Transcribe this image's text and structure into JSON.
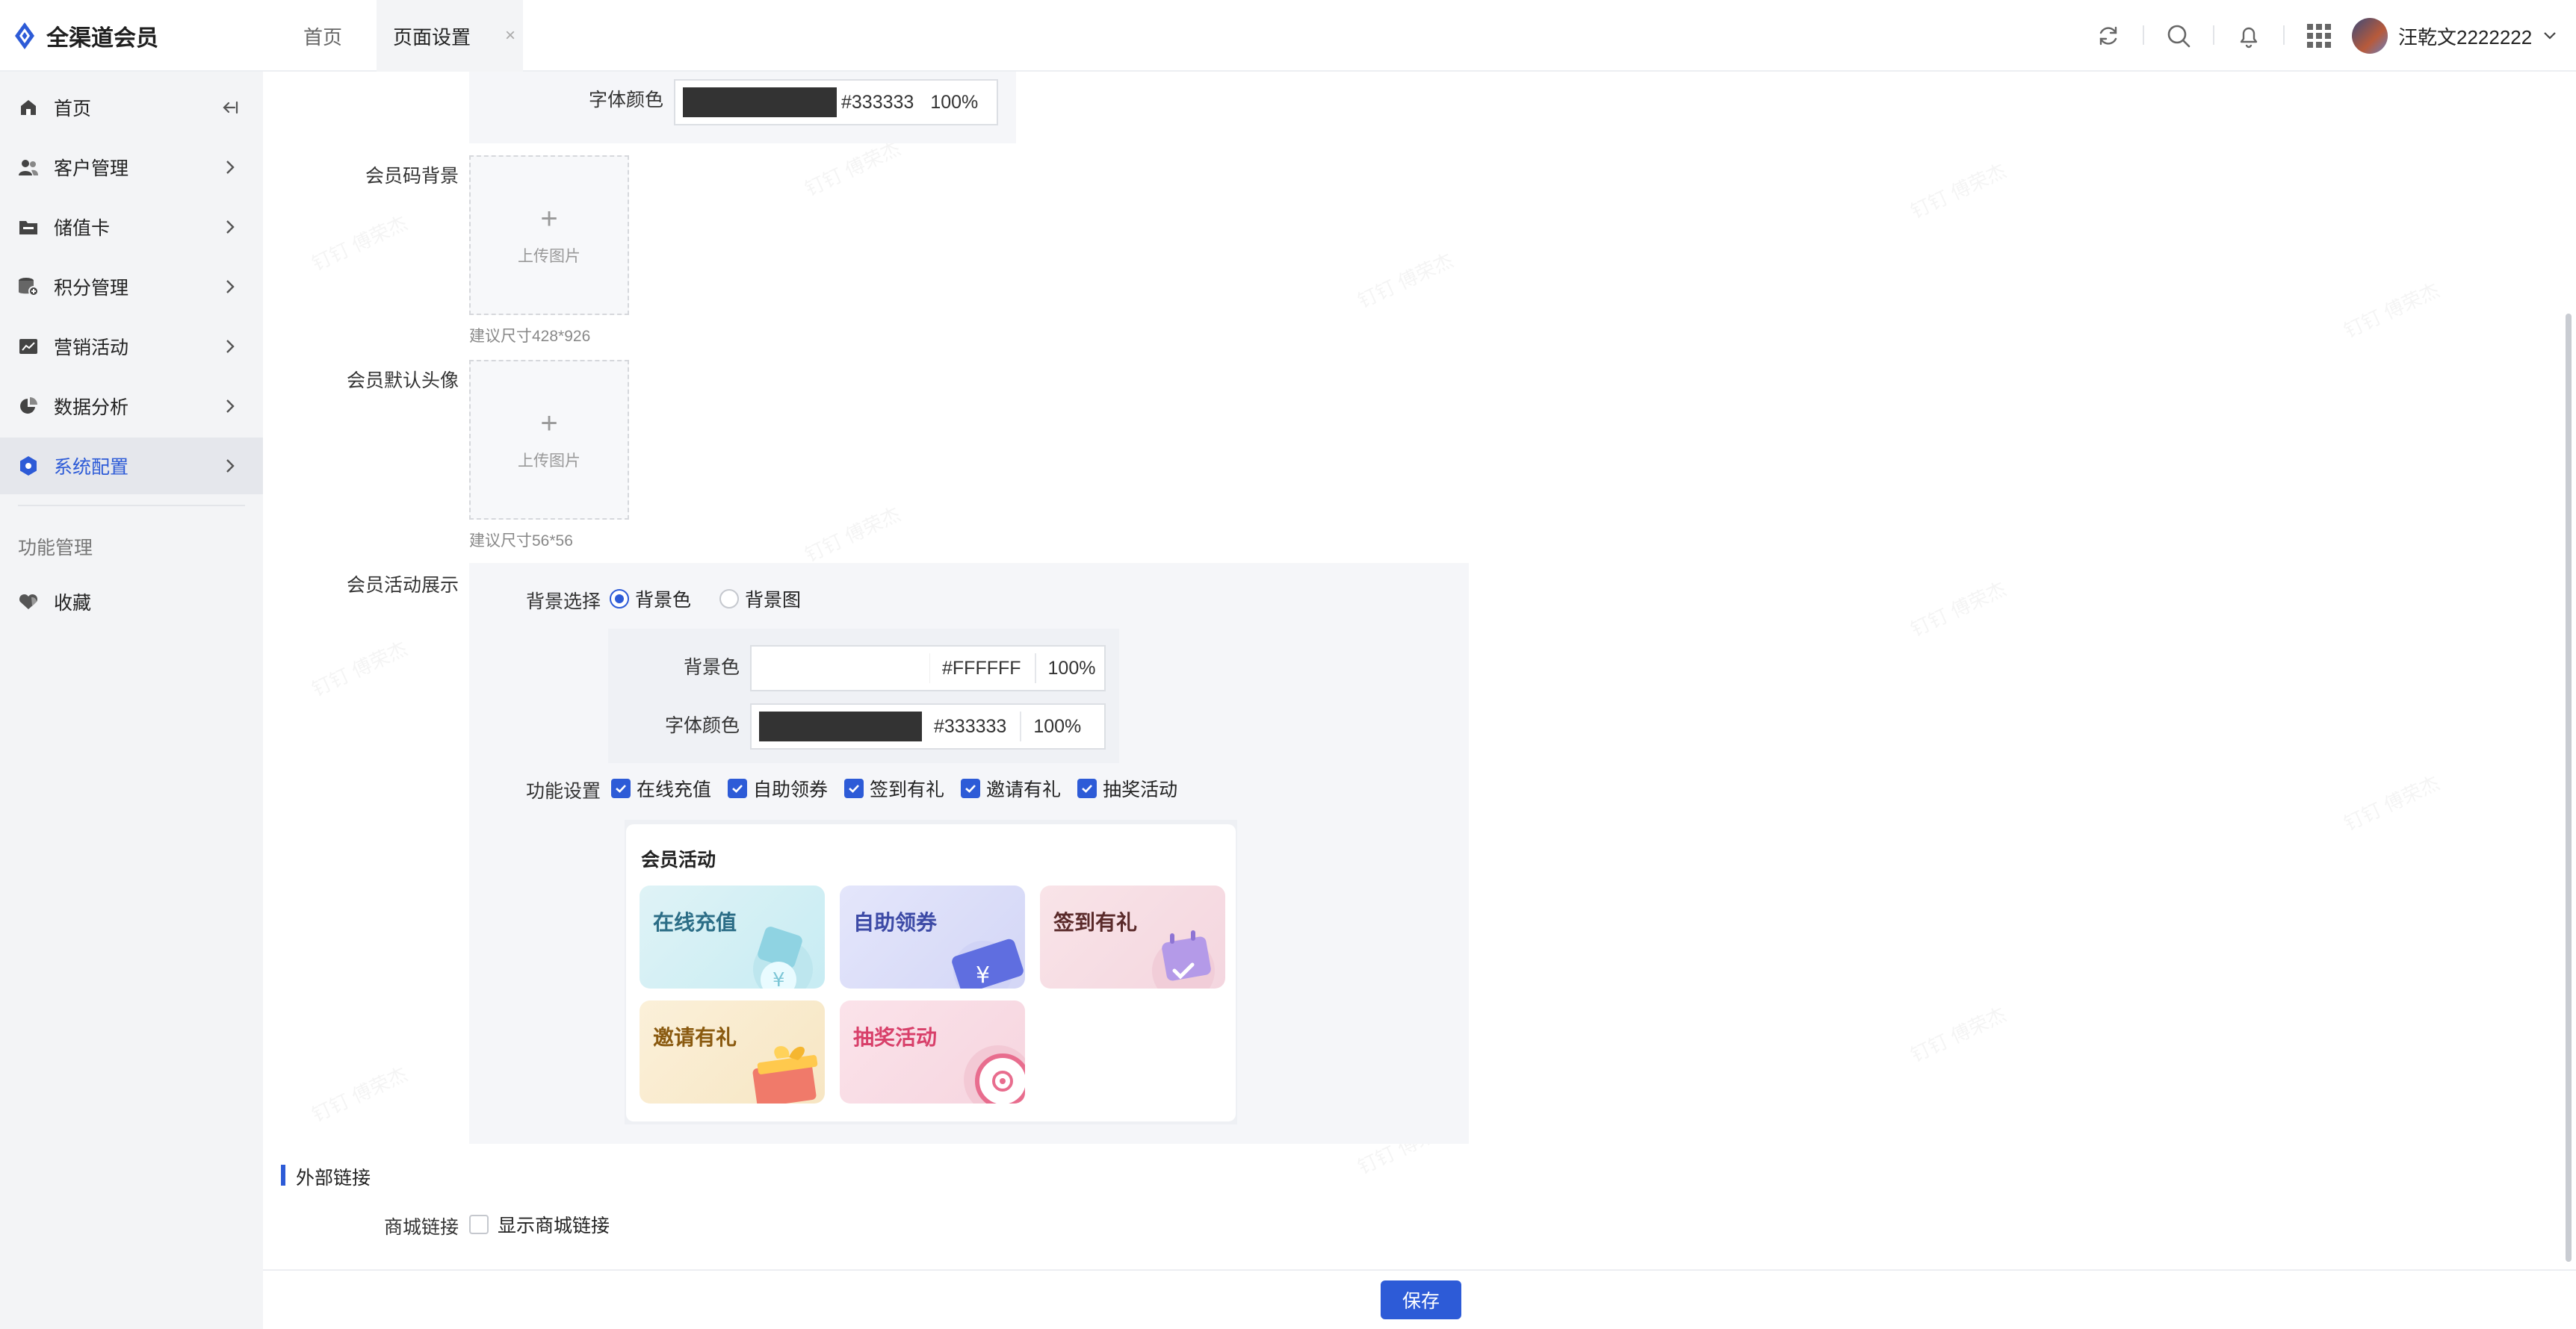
{
  "app": {
    "title": "全渠道会员"
  },
  "tabs": [
    {
      "label": "首页"
    },
    {
      "label": "页面设置",
      "close": "×"
    }
  ],
  "user": {
    "name": "汪乾文2222222"
  },
  "sidebar": {
    "items": [
      {
        "label": "首页"
      },
      {
        "label": "客户管理"
      },
      {
        "label": "储值卡"
      },
      {
        "label": "积分管理"
      },
      {
        "label": "营销活动"
      },
      {
        "label": "数据分析"
      },
      {
        "label": "系统配置"
      }
    ],
    "group_label": "功能管理",
    "favorites": {
      "label": "收藏"
    }
  },
  "form": {
    "top_font_color": {
      "label": "字体颜色",
      "hex": "#333333",
      "opacity": "100%",
      "swatch": "#333333"
    },
    "code_bg": {
      "label": "会员码背景",
      "upload": "上传图片",
      "hint": "建议尺寸428*926"
    },
    "default_avatar": {
      "label": "会员默认头像",
      "upload": "上传图片",
      "hint": "建议尺寸56*56"
    },
    "activity": {
      "label": "会员活动展示",
      "bg_choice_label": "背景选择",
      "bg_options": [
        "背景色",
        "背景图"
      ],
      "bg_color": {
        "label": "背景色",
        "hex": "#FFFFFF",
        "opacity": "100%",
        "swatch": "#FFFFFF"
      },
      "font_color": {
        "label": "字体颜色",
        "hex": "#333333",
        "opacity": "100%",
        "swatch": "#333333"
      },
      "features_label": "功能设置",
      "features": [
        "在线充值",
        "自助领券",
        "签到有礼",
        "邀请有礼",
        "抽奖活动"
      ],
      "preview": {
        "title": "会员活动",
        "cards": [
          {
            "label": "在线充值",
            "color": "#2b6d86"
          },
          {
            "label": "自助领券",
            "color": "#3d4aa6"
          },
          {
            "label": "签到有礼",
            "color": "#5a2a2a"
          },
          {
            "label": "邀请有礼",
            "color": "#8a5a10"
          },
          {
            "label": "抽奖活动",
            "color": "#d8406a"
          }
        ]
      }
    },
    "external": {
      "section_title": "外部链接",
      "mall_label": "商城链接",
      "mall_checkbox": "显示商城链接"
    }
  },
  "footer": {
    "save": "保存"
  },
  "watermark": "钉钉 傅荣杰",
  "colors": {
    "accent": "#2d5bd7"
  }
}
